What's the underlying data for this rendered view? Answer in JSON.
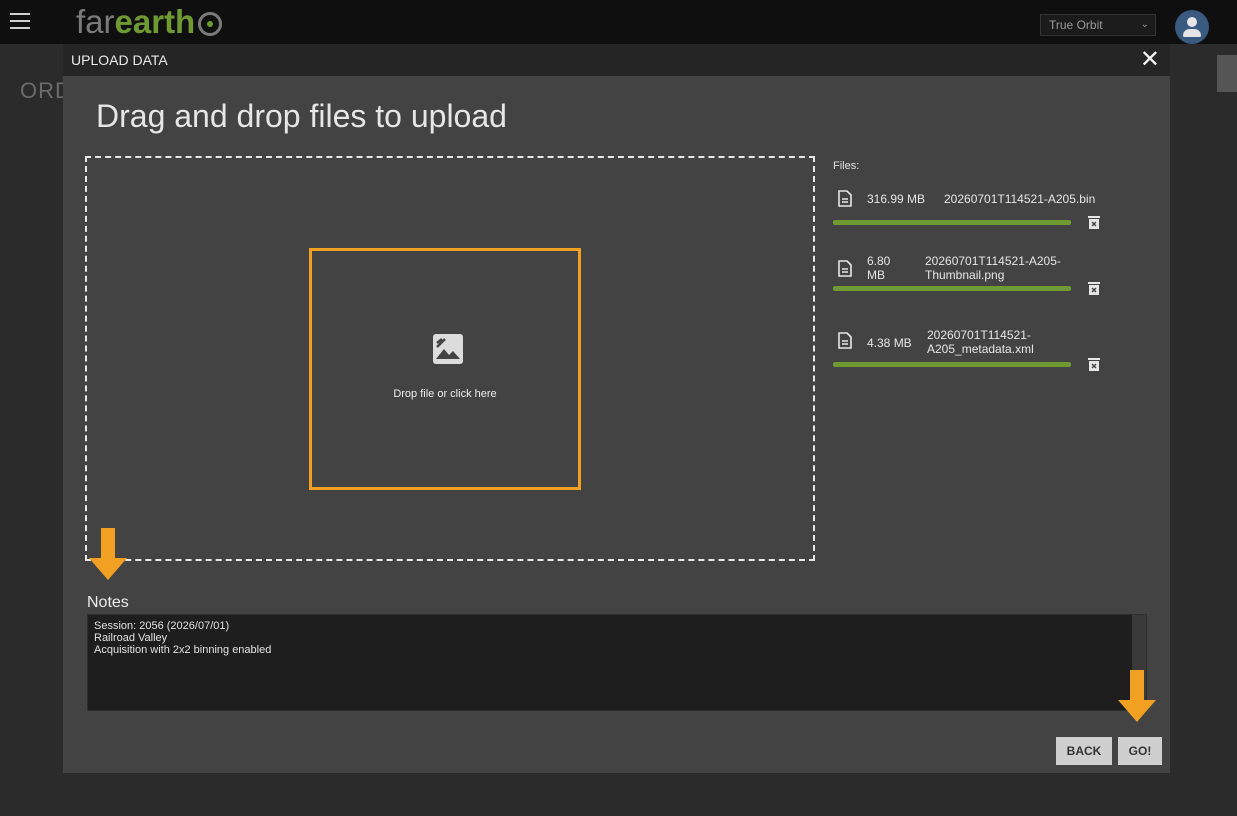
{
  "app": {
    "logo_part1": "far",
    "logo_part2": "earth"
  },
  "header": {
    "orbit_select": "True Orbit"
  },
  "background": {
    "partial_title": "ORD"
  },
  "modal": {
    "title": "UPLOAD DATA",
    "heading": "Drag and drop files to upload",
    "drop_label": "Drop file or click here",
    "files_label": "Files:",
    "files": [
      {
        "size": "316.99 MB",
        "name": "20260701T114521-A205.bin",
        "progress": 1.0
      },
      {
        "size": "6.80\nMB",
        "name": "20260701T114521-A205-\nThumbnail.png",
        "progress": 1.0
      },
      {
        "size": "4.38 MB",
        "name": "20260701T114521-\nA205_metadata.xml",
        "progress": 1.0
      }
    ],
    "notes_label": "Notes",
    "notes_lines": [
      "Session: 2056 (2026/07/01)",
      "Railroad Valley",
      "Acquisition with 2x2 binning enabled"
    ],
    "back_label": "BACK",
    "go_label": "GO!"
  },
  "colors": {
    "accent_green": "#6f9a33",
    "highlight_orange": "#f2a021"
  },
  "icons": [
    "menu-icon",
    "avatar-icon",
    "close-icon",
    "image-icon",
    "document-icon",
    "trash-icon",
    "arrow-down-icon"
  ]
}
